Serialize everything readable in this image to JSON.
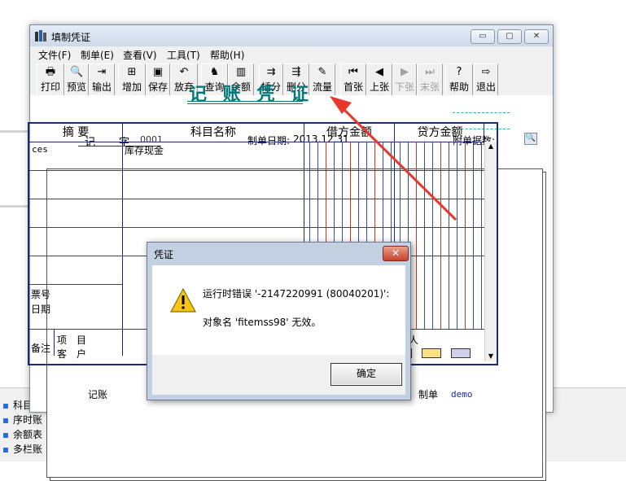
{
  "background": {
    "tree_items": [
      "科目",
      "序时账",
      "余额表",
      "多栏账"
    ]
  },
  "window": {
    "title": "填制凭证",
    "controls": {
      "minimize": "▭",
      "maximize": "▢",
      "close": "✕"
    },
    "menu": [
      "文件(F)",
      "制单(E)",
      "查看(V)",
      "工具(T)",
      "帮助(H)"
    ],
    "toolbar": [
      {
        "label": "打印",
        "icon": "printer-icon",
        "glyph": "🖶",
        "enabled": true
      },
      {
        "label": "预览",
        "icon": "preview-icon",
        "glyph": "🔍",
        "enabled": true
      },
      {
        "label": "输出",
        "icon": "export-icon",
        "glyph": "⇥",
        "enabled": true
      },
      {
        "label": "增加",
        "icon": "add-icon",
        "glyph": "⊞",
        "enabled": true
      },
      {
        "label": "保存",
        "icon": "save-icon",
        "glyph": "▣",
        "enabled": true
      },
      {
        "label": "放弃",
        "icon": "undo-icon",
        "glyph": "↶",
        "enabled": true
      },
      {
        "label": "查询",
        "icon": "binoculars-icon",
        "glyph": "♞",
        "enabled": true
      },
      {
        "label": "余额",
        "icon": "balance-chart-icon",
        "glyph": "▥",
        "enabled": true
      },
      {
        "label": "插分",
        "icon": "insert-entry-icon",
        "glyph": "⇉",
        "enabled": true
      },
      {
        "label": "删分",
        "icon": "delete-entry-icon",
        "glyph": "⇶",
        "enabled": true
      },
      {
        "label": "流量",
        "icon": "cash-flow-icon",
        "glyph": "✎",
        "enabled": true
      },
      {
        "label": "首张",
        "icon": "first-record-icon",
        "glyph": "⏮",
        "enabled": true
      },
      {
        "label": "上张",
        "icon": "previous-record-icon",
        "glyph": "◀",
        "enabled": true
      },
      {
        "label": "下张",
        "icon": "next-record-icon",
        "glyph": "▶",
        "enabled": false
      },
      {
        "label": "末张",
        "icon": "last-record-icon",
        "glyph": "⏭",
        "enabled": false
      },
      {
        "label": "帮助",
        "icon": "help-icon",
        "glyph": "?",
        "enabled": true
      },
      {
        "label": "退出",
        "icon": "exit-icon",
        "glyph": "⇨",
        "enabled": true
      }
    ]
  },
  "voucher": {
    "title": "记 账 凭 证",
    "type_label": "记",
    "number_label": "字",
    "number": "0001",
    "date_label": "制单日期:",
    "date": "2013.12.31",
    "attachments_label": "附单据数:",
    "columns": [
      "摘 要",
      "科目名称",
      "借方金额",
      "贷方金额"
    ],
    "rows": [
      {
        "summary": "ces",
        "account": "库存现金"
      }
    ],
    "ticket_no_label": "票号",
    "date_field_label": "日期",
    "remarks_label": "备注",
    "project_label": "项",
    "project_label2": "目",
    "customer_label": "客",
    "customer_label2": "户",
    "personal_label": "个　人",
    "bookkeeper_label": "记账",
    "preparer_label": "制单",
    "preparer": "demo"
  },
  "dialog": {
    "title": "凭证",
    "close": "✕",
    "icon": "warning-icon",
    "message_line1": "运行时错误 '-2147220991 (80040201)':",
    "message_line2": "对象名 'fitemss98' 无效。",
    "ok_label": "确定"
  },
  "colors": {
    "accent": "#007a7a",
    "arrow": "#e8382b",
    "grid_blue": "#3350a8",
    "grid_red": "#c0392b"
  }
}
